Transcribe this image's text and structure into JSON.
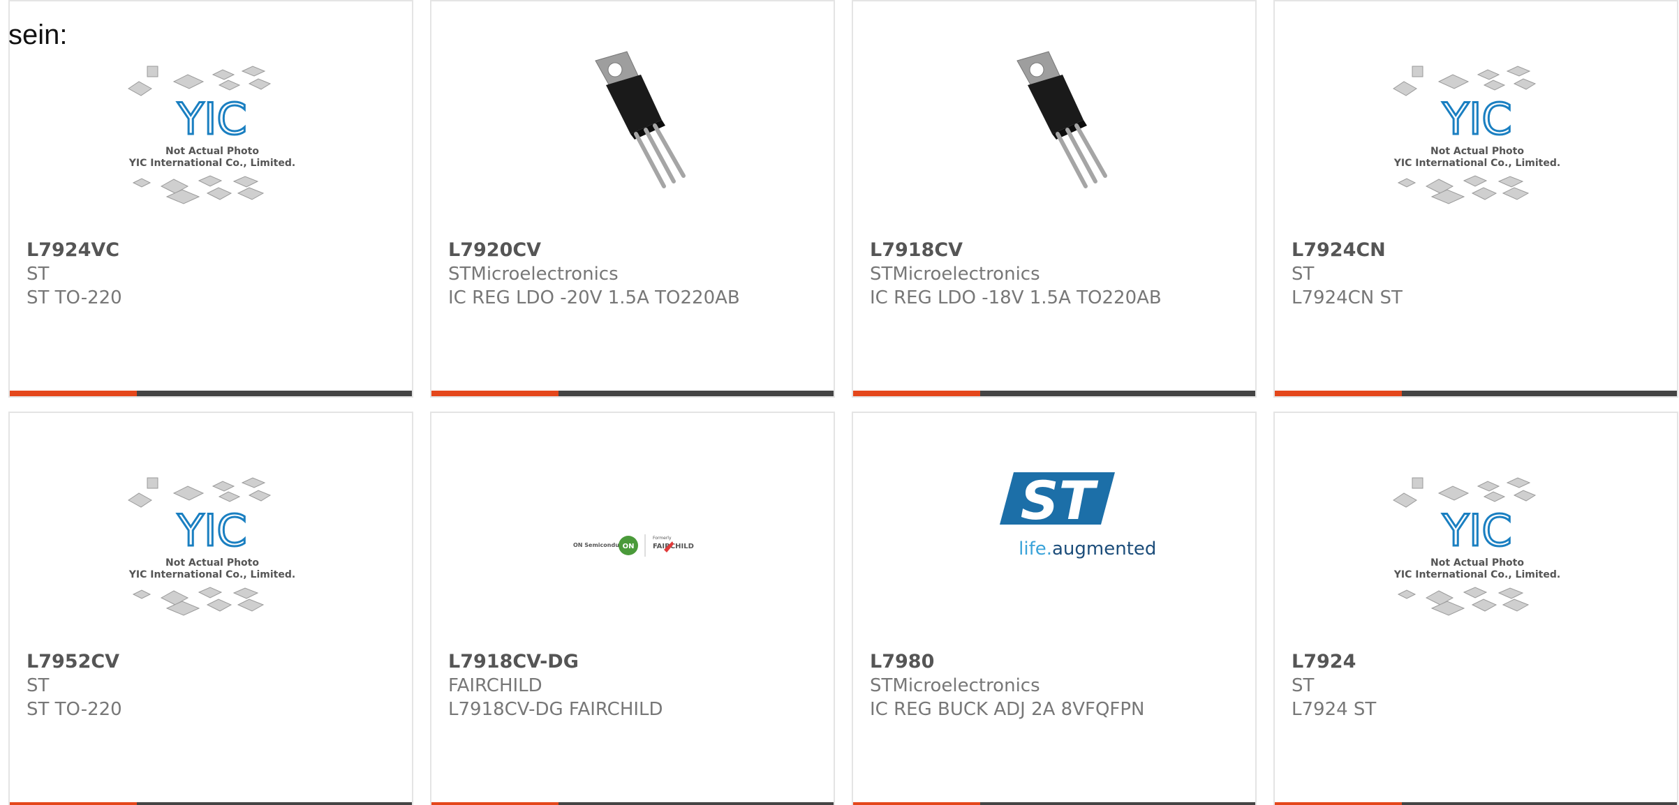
{
  "intro": {
    "label": "sein:"
  },
  "colors": {
    "accent": "#e4471b",
    "bar": "#444444",
    "yic_blue": "#1a7fc1",
    "st_blue": "#1c6fa8"
  },
  "products": [
    {
      "part": "L7924VC",
      "manufacturer": "ST",
      "description": "ST TO-220",
      "image": "placeholder",
      "placeholder_text": [
        "Not Actual Photo",
        "YIC International Co., Limited."
      ]
    },
    {
      "part": "L7920CV",
      "manufacturer": "STMicroelectronics",
      "description": "IC REG LDO -20V 1.5A TO220AB",
      "image": "to220"
    },
    {
      "part": "L7918CV",
      "manufacturer": "STMicroelectronics",
      "description": "IC REG LDO -18V 1.5A TO220AB",
      "image": "to220"
    },
    {
      "part": "L7924CN",
      "manufacturer": "ST",
      "description": "L7924CN ST",
      "image": "placeholder",
      "placeholder_text": [
        "Not Actual Photo",
        "YIC International Co., Limited."
      ]
    },
    {
      "part": "L7952CV",
      "manufacturer": "ST",
      "description": "ST TO-220",
      "image": "placeholder",
      "placeholder_text": [
        "Not Actual Photo",
        "YIC International Co., Limited."
      ]
    },
    {
      "part": "L7918CV-DG",
      "manufacturer": "FAIRCHILD",
      "description": "L7918CV-DG FAIRCHILD",
      "image": "fairchild-logo",
      "logo_text": [
        "ON Semiconductor",
        "ON",
        "Formerly",
        "FAIRCHILD"
      ]
    },
    {
      "part": "L7980",
      "manufacturer": "STMicroelectronics",
      "description": "IC REG BUCK ADJ 2A 8VFQFPN",
      "image": "st-logo",
      "logo_text": [
        "ST",
        "life.",
        "augmented"
      ]
    },
    {
      "part": "L7924",
      "manufacturer": "ST",
      "description": "L7924 ST",
      "image": "placeholder",
      "placeholder_text": [
        "Not Actual Photo",
        "YIC International Co., Limited."
      ]
    }
  ]
}
